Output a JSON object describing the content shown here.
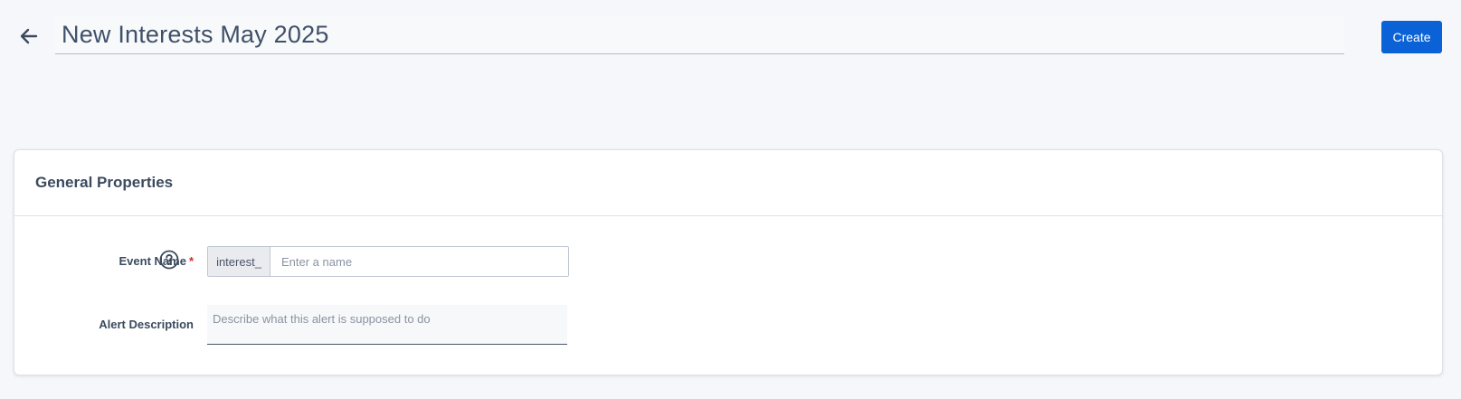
{
  "header": {
    "back_icon": "arrow-left-icon",
    "title": "New Interests May 2025",
    "create_label": "Create"
  },
  "colors": {
    "primary": "#0a62d6",
    "required": "#d62b2b",
    "text": "#3b4a5e",
    "background": "#f6f7fa"
  },
  "general_properties": {
    "title": "General Properties",
    "event_name": {
      "label": "Event Name",
      "required_mark": "*",
      "help_icon": "question-circle-icon",
      "prefix": "interest_",
      "value": "",
      "placeholder": "Enter a name"
    },
    "alert_description": {
      "label": "Alert Description",
      "value": "",
      "placeholder": "Describe what this alert is supposed to do"
    }
  }
}
